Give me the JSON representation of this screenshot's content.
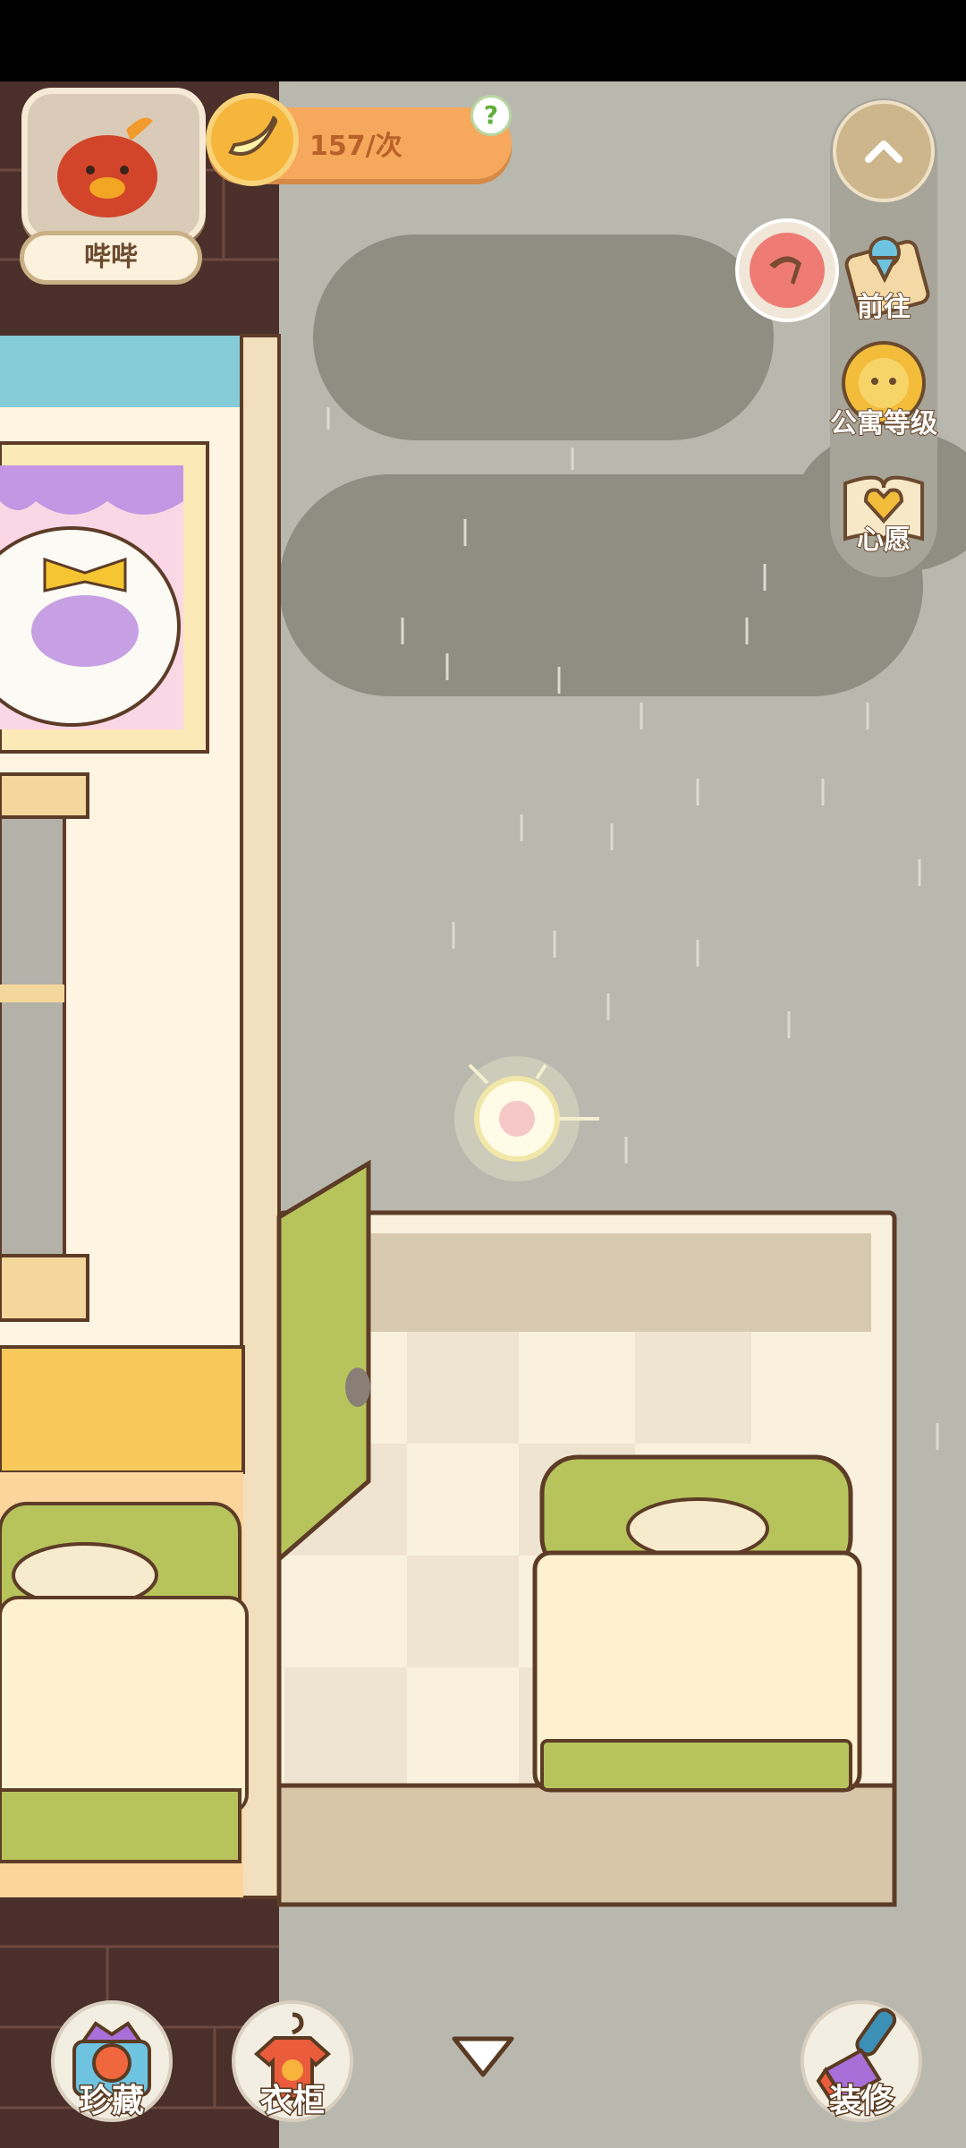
{
  "player": {
    "name": "哔哔"
  },
  "currency": {
    "value": "157/次",
    "help_symbol": "?"
  },
  "side_menu": {
    "goto_label": "前往",
    "apartment_level_label": "公寓等级",
    "wish_label": "心愿"
  },
  "bottom_bar": {
    "collection_label": "珍藏",
    "wardrobe_label": "衣柜",
    "decorate_label": "装修"
  },
  "colors": {
    "sky_rain": "#b9b8ae",
    "brick": "#4a2f2a",
    "bed_green": "#b7c45c",
    "accent_orange": "#f6a85c"
  }
}
